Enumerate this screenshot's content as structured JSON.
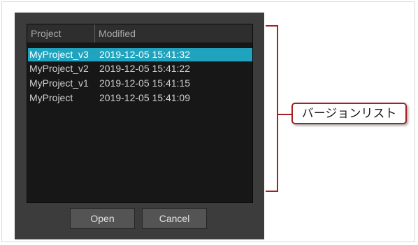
{
  "list": {
    "columns": {
      "project": "Project",
      "modified": "Modified"
    },
    "rows": [
      {
        "name": "MyProject_v3",
        "modified": "2019-12-05 15:41:32",
        "selected": true
      },
      {
        "name": "MyProject_v2",
        "modified": "2019-12-05 15:41:22",
        "selected": false
      },
      {
        "name": "MyProject_v1",
        "modified": "2019-12-05 15:41:15",
        "selected": false
      },
      {
        "name": "MyProject",
        "modified": "2019-12-05 15:41:09",
        "selected": false
      }
    ]
  },
  "buttons": {
    "open": "Open",
    "cancel": "Cancel"
  },
  "annotation": {
    "label": "バージョンリスト"
  },
  "colors": {
    "selection": "#1fa3be",
    "annotation": "#a32023",
    "dialog": "#3c3c3c"
  }
}
